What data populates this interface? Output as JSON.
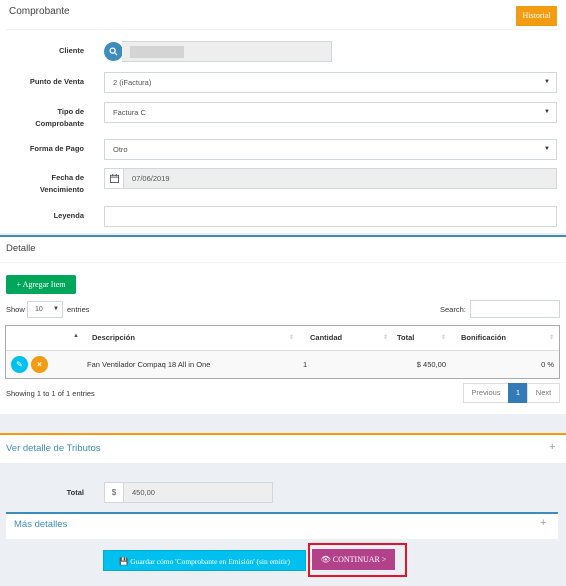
{
  "comprobante": {
    "title": "Comprobante",
    "historial_label": "Historial",
    "fields": {
      "cliente_label": "Cliente",
      "cliente_value": "",
      "punto_venta_label": "Punto de Venta",
      "punto_venta_value": "2 (iFactura)",
      "tipo_label_1": "Tipo de",
      "tipo_label_2": "Comprobante",
      "tipo_value": "Factura C",
      "forma_pago_label": "Forma de Pago",
      "forma_pago_value": "Otro",
      "fecha_label_1": "Fecha de",
      "fecha_label_2": "Vencimiento",
      "fecha_value": "07/06/2019",
      "leyenda_label": "Leyenda",
      "leyenda_value": ""
    }
  },
  "detalle": {
    "title": "Detalle",
    "add_button": "+ Agregar Item",
    "show_label": "Show",
    "entries_select": "10",
    "entries_label": "entries",
    "search_label": "Search:",
    "search_value": "",
    "columns": [
      "Descripción",
      "Cantidad",
      "Total",
      "Bonificación"
    ],
    "rows": [
      {
        "descripcion": "Fan Ventilador Compaq 18 All in One",
        "cantidad": "1",
        "total": "$ 450,00",
        "bonificacion": "0 %"
      }
    ],
    "info": "Showing 1 to 1 of 1 entries",
    "pagination": {
      "previous": "Previous",
      "page": "1",
      "next": "Next"
    }
  },
  "tributos": {
    "title": "Ver detalle de Tributos",
    "toggle": "+"
  },
  "total": {
    "label": "Total",
    "currency": "$",
    "value": "450,00"
  },
  "mas_detalles": {
    "title": "Más detalles",
    "toggle": "+"
  },
  "actions": {
    "guardar": "Guardar cómo 'Comprobante en Emisión' (sin emitir)",
    "continuar": "CONTINUAR >"
  },
  "colors": {
    "primary": "#3c8dbc",
    "warning": "#f39c12",
    "success": "#00a65a",
    "info": "#00c0ef",
    "continue": "#b3418a",
    "highlight": "#e8112d"
  }
}
